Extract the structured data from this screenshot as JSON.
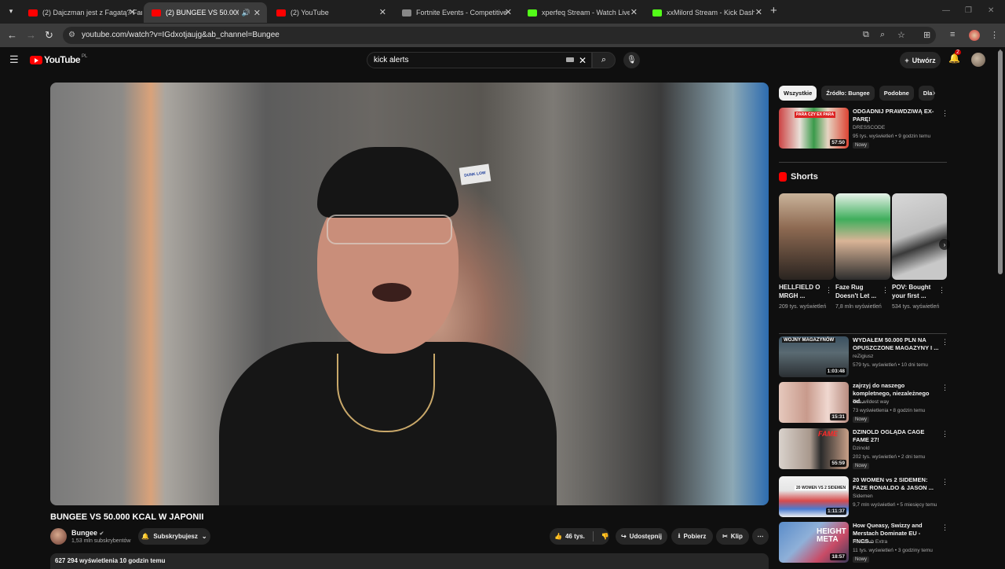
{
  "browser": {
    "tabs": [
      {
        "title": "(2) Dajczman jest z Fagatą? Fam",
        "icon": "youtube-favicon"
      },
      {
        "title": "(2) BUNGEE VS 50.000 KCAL",
        "icon": "youtube-favicon",
        "active": true
      },
      {
        "title": "(2) YouTube",
        "icon": "youtube-favicon"
      },
      {
        "title": "Fortnite Events - Competitive T",
        "icon": "fortnite-favicon"
      },
      {
        "title": "xperfeq Stream - Watch Live or",
        "icon": "kick-favicon"
      },
      {
        "title": "xxMilord Stream - Kick Dashbo",
        "icon": "kick-favicon"
      }
    ],
    "url": "youtube.com/watch?v=IGdxotjaujg&ab_channel=Bungee"
  },
  "header": {
    "logo_text": "YouTube",
    "logo_country": "PL",
    "search_query": "kick alerts",
    "create_label": "Utwórz",
    "notification_count": "2"
  },
  "video": {
    "sticker_text": "DUNK LOW",
    "title": "BUNGEE VS 50.000 KCAL W JAPONII",
    "channel_name": "Bungee",
    "subscribers": "1,53 mln subskrybentów",
    "subscribe_label": "Subskrybujesz",
    "likes": "46 tys.",
    "share_label": "Udostępnij",
    "download_label": "Pobierz",
    "clip_label": "Klip",
    "views_line": "627 294 wyświetlenia  10 godzin temu"
  },
  "chips": [
    "Wszystkie",
    "Źródło: Bungee",
    "Podobne",
    "Dla"
  ],
  "top_rec": {
    "title": "ODGADNIJ PRAWDZIWĄ EX-PARĘ!",
    "channel": "DRESSCODE",
    "meta": "95 tys. wyświetleń • 9 godzin temu",
    "badge": "Nowy",
    "duration": "57:50",
    "thumb_text": "PARA CZY EX PARA"
  },
  "shorts": {
    "heading": "Shorts",
    "items": [
      {
        "title": "HELLFIELD O MRGH ...",
        "views": "209 tys. wyświetleń"
      },
      {
        "title": "Faze Rug Doesn't Let ...",
        "views": "7,8 mln wyświetleń"
      },
      {
        "title": "POV: Bought your first ...",
        "views": "534 tys. wyświetleń"
      }
    ]
  },
  "recommendations": [
    {
      "title": "WYDAŁEM 50.000 PLN NA OPUSZCZONE MAGAZYNY I ...",
      "channel": "reZigiusz",
      "meta": "579 tys. wyświetleń • 10 dni temu",
      "duration": "1:03:48",
      "thumb_text": "WOJNY MAGAZYNÓW",
      "badge": ""
    },
    {
      "title": "zajrzyj do naszego kompletnego, niezależnego od...",
      "channel": "The wildest way",
      "meta": "73 wyświetlenia • 8 godzin temu",
      "duration": "15:31",
      "thumb_text": "",
      "badge": "Nowy"
    },
    {
      "title": "DZINOLD OGLĄDA CAGE FAME 27!",
      "channel": "Dzinold",
      "meta": "202 tys. wyświetleń • 2 dni temu",
      "duration": "55:59",
      "thumb_text": "FAME",
      "badge": "Nowy"
    },
    {
      "title": "20 WOMEN vs 2 SIDEMEN: FAZE RONALDO & JASON ...",
      "channel": "Sidemen",
      "meta": "9,7 mln wyświetleń • 5 miesięcy temu",
      "duration": "1:11:37",
      "thumb_text": "20 WOMEN VS 2 SIDEMEN",
      "badge": ""
    },
    {
      "title": "How Queasy, Swizzy and Merstach Dominate EU - FNCS...",
      "channel": "Reisshub Extra",
      "meta": "11 tys. wyświetleń • 3 godziny temu",
      "duration": "18:57",
      "thumb_text": "HEIGHT META",
      "badge": "Nowy"
    }
  ],
  "colors": {
    "background": "#0f0f0f",
    "accent": "#ff0000",
    "surface": "#272727"
  }
}
